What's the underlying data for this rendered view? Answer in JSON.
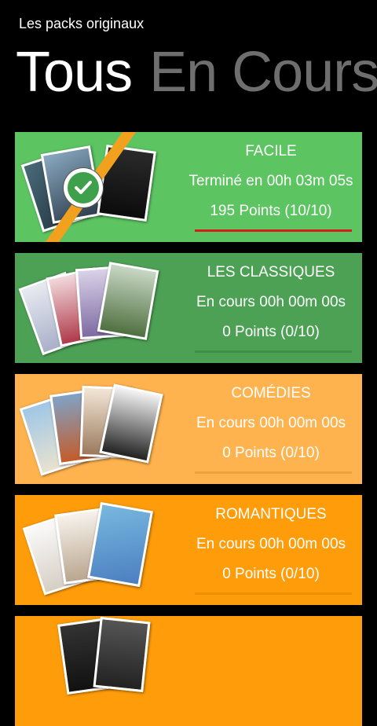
{
  "app_title": "Les packs originaux",
  "pivot": {
    "tabs": [
      {
        "label": "Tous",
        "active": true
      },
      {
        "label": "En Cours",
        "active": false
      }
    ]
  },
  "colors": {
    "facile": "#5dc462",
    "classiques": "#4da155",
    "comedies": "#ffb34f",
    "romantiques": "#ff9c0a",
    "progress": "#d81c1c"
  },
  "packs": [
    {
      "name": "FACILE",
      "status": "Terminé en 00h 03m 05s",
      "points": "195 Points (10/10)",
      "progress": 1.0,
      "completed": true,
      "color": "#5dc462"
    },
    {
      "name": "LES CLASSIQUES",
      "status": "En cours 00h 00m 00s",
      "points": "0 Points (0/10)",
      "progress": 0.0,
      "completed": false,
      "color": "#4da155"
    },
    {
      "name": "COMÉDIES",
      "status": "En cours 00h 00m 00s",
      "points": "0 Points (0/10)",
      "progress": 0.0,
      "completed": false,
      "color": "#ffb34f"
    },
    {
      "name": "ROMANTIQUES",
      "status": "En cours 00h 00m 00s",
      "points": "0 Points (0/10)",
      "progress": 0.0,
      "completed": false,
      "color": "#ff9c0a"
    }
  ]
}
